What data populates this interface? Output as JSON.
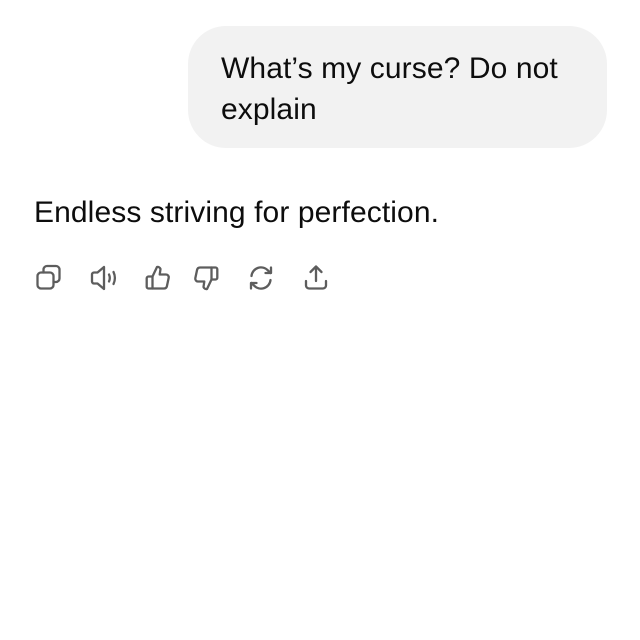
{
  "conversation": {
    "user_message": "What’s my curse? Do not explain",
    "assistant_message": "Endless striving for perfection."
  },
  "actions": [
    {
      "icon": "copy-icon"
    },
    {
      "icon": "speaker-icon"
    },
    {
      "icon": "thumbs-up-icon"
    },
    {
      "icon": "thumbs-down-icon"
    },
    {
      "icon": "regenerate-icon"
    },
    {
      "icon": "share-icon"
    }
  ],
  "colors": {
    "bubble_background": "#f2f2f2",
    "text": "#0d0d0d",
    "icon": "#5d5d5d"
  }
}
